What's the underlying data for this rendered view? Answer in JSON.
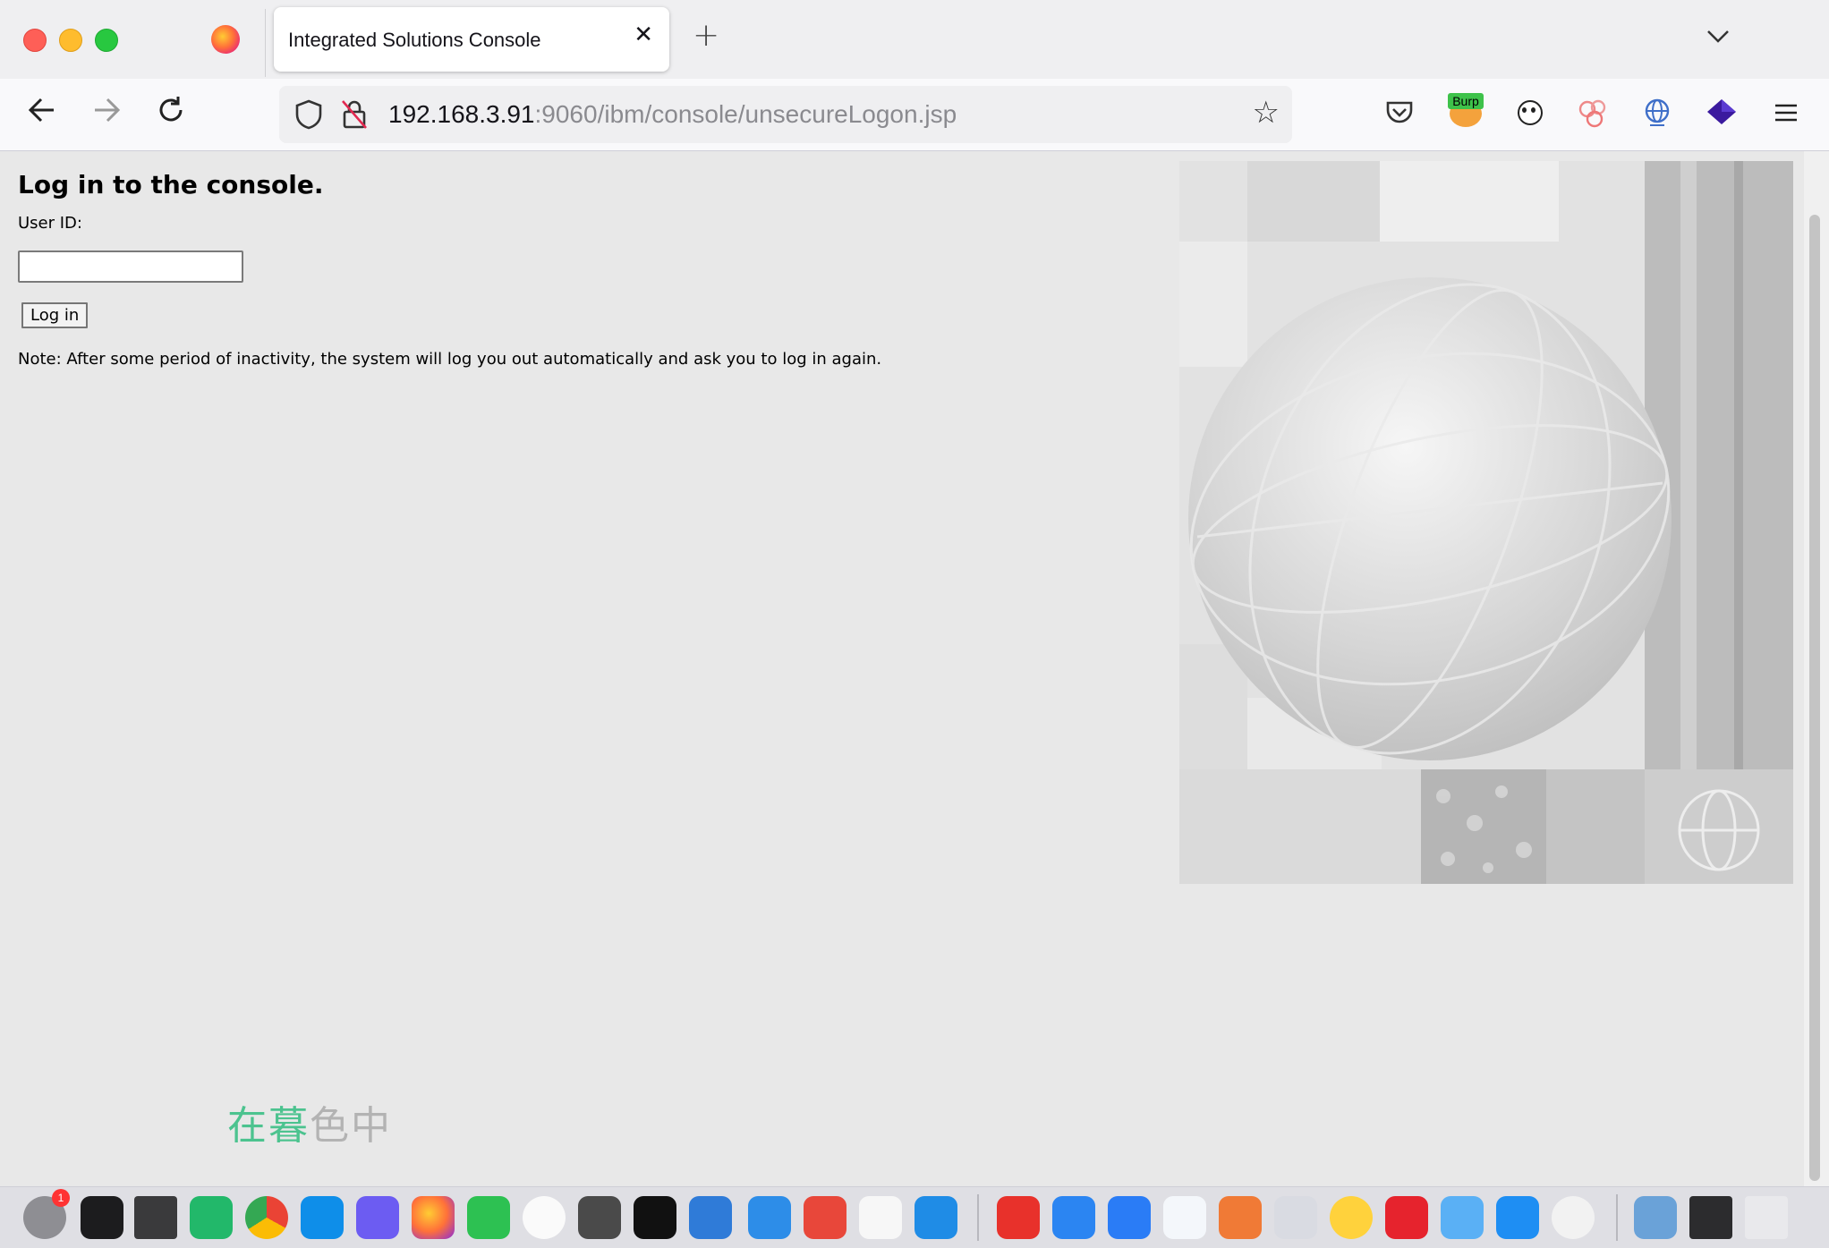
{
  "browser": {
    "tab": {
      "title": "Integrated Solutions Console"
    },
    "url": {
      "host": "192.168.3.91",
      "path": ":9060/ibm/console/unsecureLogon.jsp"
    },
    "extensions": [
      "pocket-icon",
      "burp-icon",
      "panda-icon",
      "bubbles-icon",
      "globe-network-icon",
      "layers-icon",
      "menu-icon"
    ],
    "burp_label": "Burp"
  },
  "login": {
    "heading": "Log in to the console.",
    "user_id_label": "User ID:",
    "user_id_value": "",
    "button_label": "Log in",
    "note": "Note: After some period of inactivity, the system will log you out automatically and ask you to log in again."
  },
  "watermark": {
    "part1": "在暮",
    "part2": "色中"
  },
  "dock": {
    "badge_count": "1",
    "apps": [
      "system-preferences-icon",
      "terminal-icon",
      "screen-sharing-icon",
      "feishu-icon",
      "chrome-icon",
      "teamviewer-icon",
      "bolt-app-icon",
      "firefox-icon",
      "wechat-icon",
      "qq-icon",
      "sublime-icon",
      "activity-monitor-icon",
      "parallels-icon",
      "sketch-icon",
      "xmind-icon",
      "typora-icon",
      "vscode-icon",
      "wps-icon",
      "baidu-netdisk-icon",
      "dingtalk-icon",
      "search-app-icon",
      "pen-app-icon",
      "preview-icon",
      "music-icon",
      "weibo-icon",
      "folder-icon",
      "app-store-icon",
      "sync-icon",
      "coffee-icon",
      "terminal-window-icon",
      "desktop-icon"
    ]
  },
  "colors": {
    "page_bg": "#e8e8e8",
    "accent_green": "#4cc38f"
  }
}
